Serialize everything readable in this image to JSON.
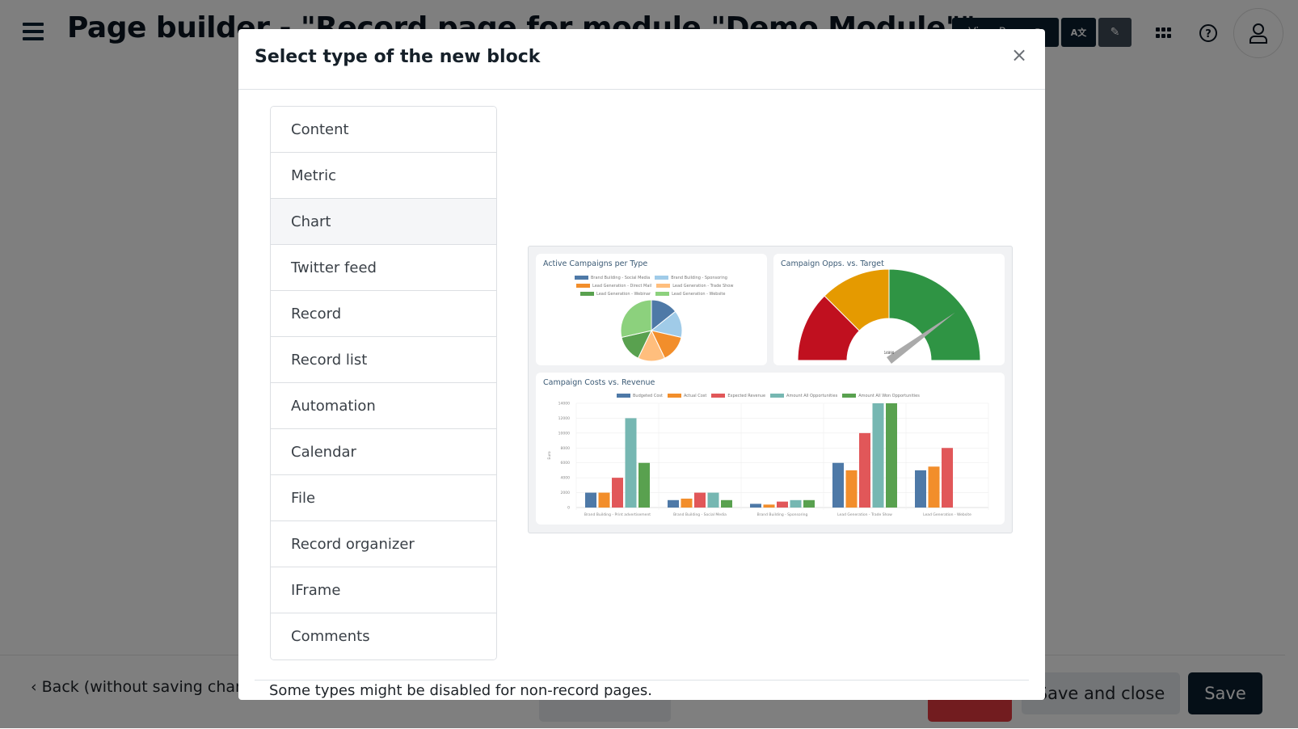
{
  "header": {
    "title": "Page builder - \"Record page for module \"Demo Module\"\"",
    "view_page_label": "View Page",
    "icons": [
      "menu-icon",
      "eye-icon",
      "translate-icon",
      "edit-icon",
      "apps-grid-icon",
      "help-icon",
      "user-icon"
    ]
  },
  "footer": {
    "back_label": "Back (without saving changes)",
    "save_and_close_label": "Save and close",
    "save_label": "Save"
  },
  "modal": {
    "title": "Select type of the new block",
    "close_symbol": "×",
    "types": [
      {
        "label": "Content",
        "active": false
      },
      {
        "label": "Metric",
        "active": false
      },
      {
        "label": "Chart",
        "active": true
      },
      {
        "label": "Twitter feed",
        "active": false
      },
      {
        "label": "Record",
        "active": false
      },
      {
        "label": "Record list",
        "active": false
      },
      {
        "label": "Automation",
        "active": false
      },
      {
        "label": "Calendar",
        "active": false
      },
      {
        "label": "File",
        "active": false
      },
      {
        "label": "Record organizer",
        "active": false
      },
      {
        "label": "IFrame",
        "active": false
      },
      {
        "label": "Comments",
        "active": false
      }
    ],
    "note": "Some types might be disabled for non-record pages."
  },
  "chart_data": [
    {
      "type": "pie",
      "title": "Active Campaigns per Type",
      "legend": "top",
      "categories": [
        "Brand Building - Social Media",
        "Brand Building - Sponsoring",
        "Lead Generation - Direct Mail",
        "Lead Generation - Trade Show",
        "Lead Generation - Webinar",
        "Lead Generation - Website"
      ],
      "values": [
        1,
        1,
        1,
        1,
        1,
        2
      ],
      "colors": [
        "#4e79a7",
        "#a0cbe8",
        "#f28e2b",
        "#ffbe7d",
        "#59a14f",
        "#8cd17d"
      ]
    },
    {
      "type": "gauge",
      "title": "Campaign Opps. vs. Target",
      "bands": [
        {
          "from": 0,
          "to": 0.25,
          "color": "#c0101f"
        },
        {
          "from": 0.25,
          "to": 0.5,
          "color": "#e59a00"
        },
        {
          "from": 0.5,
          "to": 1.0,
          "color": "#2f9444"
        }
      ],
      "needle": 0.8,
      "value_label": "14890"
    },
    {
      "type": "bar",
      "title": "Campaign Costs vs. Revenue",
      "xlabel": "",
      "ylabel": "Euro",
      "ylim": [
        0,
        14000
      ],
      "yticks": [
        0,
        2000,
        4000,
        6000,
        8000,
        10000,
        12000,
        14000
      ],
      "legend": "top",
      "grid": true,
      "categories": [
        "Brand Building - Print advertisement",
        "Brand Building - Social Media",
        "Brand Building - Sponsoring",
        "Lead Generation - Trade Show",
        "Lead Generation - Website"
      ],
      "series": [
        {
          "name": "Budgeted Cost",
          "color": "#4e79a7",
          "values": [
            2000,
            1000,
            500,
            6000,
            5000
          ]
        },
        {
          "name": "Actual Cost",
          "color": "#f28e2b",
          "values": [
            2000,
            1200,
            400,
            5000,
            5500
          ]
        },
        {
          "name": "Expected Revenue",
          "color": "#e15759",
          "values": [
            4000,
            2000,
            800,
            10000,
            8000
          ]
        },
        {
          "name": "Amount All Opportunities",
          "color": "#76b7b2",
          "values": [
            12000,
            2000,
            1000,
            14000,
            0
          ]
        },
        {
          "name": "Amount All Won Opportunities",
          "color": "#59a14f",
          "values": [
            6000,
            1000,
            1000,
            14000,
            0
          ]
        }
      ]
    }
  ]
}
